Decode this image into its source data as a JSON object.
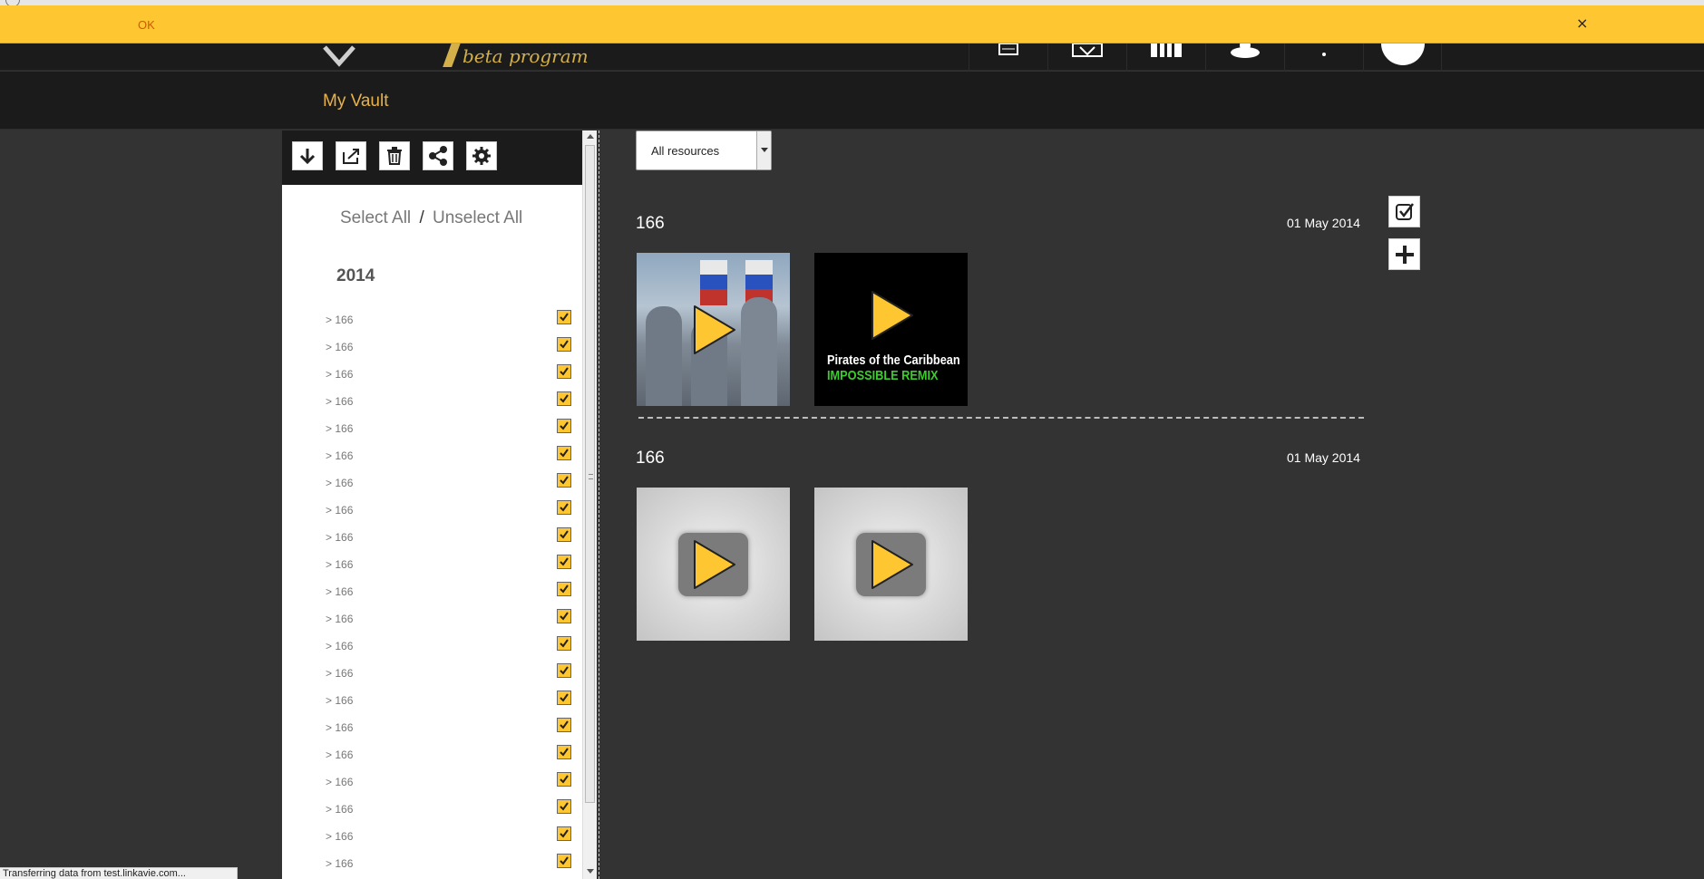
{
  "notification": {
    "ok_label": "OK",
    "close_label": "×"
  },
  "header": {
    "beta_label": "beta program",
    "nav_icons": [
      "calendar-icon",
      "photo-icon",
      "piano-icon",
      "profile-silhouette-icon",
      "more-icon",
      "avatar"
    ]
  },
  "subheader": {
    "title": "My Vault"
  },
  "toolbar": {
    "buttons": [
      "download-icon",
      "export-icon",
      "delete-icon",
      "share-icon",
      "settings-icon"
    ]
  },
  "sidebar": {
    "select_all": "Select All",
    "separator": "/",
    "unselect_all": "Unselect All",
    "year": "2014",
    "items": [
      {
        "label": "> 166",
        "checked": true
      },
      {
        "label": "> 166",
        "checked": true
      },
      {
        "label": "> 166",
        "checked": true
      },
      {
        "label": "> 166",
        "checked": true
      },
      {
        "label": "> 166",
        "checked": true
      },
      {
        "label": "> 166",
        "checked": true
      },
      {
        "label": "> 166",
        "checked": true
      },
      {
        "label": "> 166",
        "checked": true
      },
      {
        "label": "> 166",
        "checked": true
      },
      {
        "label": "> 166",
        "checked": true
      },
      {
        "label": "> 166",
        "checked": true
      },
      {
        "label": "> 166",
        "checked": true
      },
      {
        "label": "> 166",
        "checked": true
      },
      {
        "label": "> 166",
        "checked": true
      },
      {
        "label": "> 166",
        "checked": true
      },
      {
        "label": "> 166",
        "checked": true
      },
      {
        "label": "> 166",
        "checked": true
      },
      {
        "label": "> 166",
        "checked": true
      },
      {
        "label": "> 166",
        "checked": true
      },
      {
        "label": "> 166",
        "checked": true
      },
      {
        "label": "> 166",
        "checked": true
      }
    ]
  },
  "filter": {
    "selected": "All resources"
  },
  "groups": [
    {
      "title": "166",
      "date": "01 May 2014"
    },
    {
      "title": "166",
      "date": "01 May 2014"
    }
  ],
  "thumbnails": {
    "video2_line1": "Pirates of the Caribbean",
    "video2_line2": "IMPOSSIBLE REMIX"
  },
  "status": {
    "text": "Transferring data from test.linkavie.com..."
  },
  "colors": {
    "accent": "#fec631",
    "vault_title": "#e8b24a",
    "background": "#333333",
    "header": "#1b1b1b"
  }
}
